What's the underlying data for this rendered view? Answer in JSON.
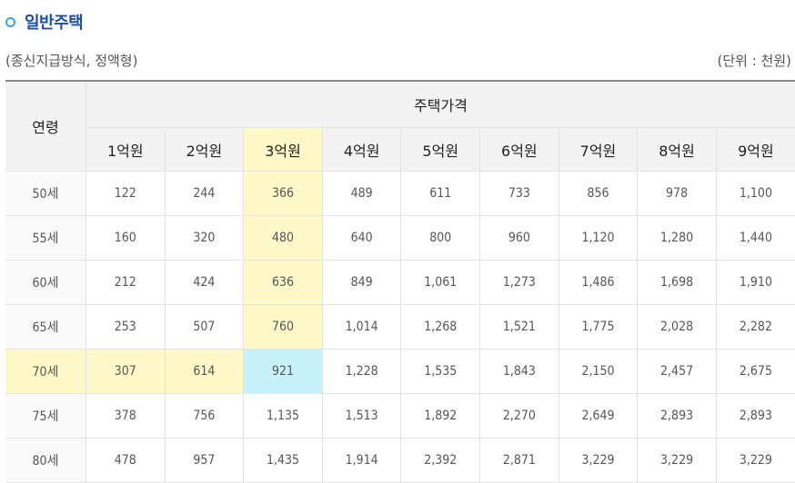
{
  "section": {
    "title": "일반주택",
    "subtitle": "(종신지급방식, 정액형)",
    "unit": "(단위 : 천원)"
  },
  "table": {
    "age_header": "연령",
    "group_header": "주택가격",
    "price_headers": [
      "1억원",
      "2억원",
      "3억원",
      "4억원",
      "5억원",
      "6억원",
      "7억원",
      "8억원",
      "9억원"
    ],
    "rows": [
      {
        "age": "50세",
        "values": [
          "122",
          "244",
          "366",
          "489",
          "611",
          "733",
          "856",
          "978",
          "1,100"
        ]
      },
      {
        "age": "55세",
        "values": [
          "160",
          "320",
          "480",
          "640",
          "800",
          "960",
          "1,120",
          "1,280",
          "1,440"
        ]
      },
      {
        "age": "60세",
        "values": [
          "212",
          "424",
          "636",
          "849",
          "1,061",
          "1,273",
          "1,486",
          "1,698",
          "1,910"
        ]
      },
      {
        "age": "65세",
        "values": [
          "253",
          "507",
          "760",
          "1,014",
          "1,268",
          "1,521",
          "1,775",
          "2,028",
          "2,282"
        ]
      },
      {
        "age": "70세",
        "values": [
          "307",
          "614",
          "921",
          "1,228",
          "1,535",
          "1,843",
          "2,150",
          "2,457",
          "2,675"
        ]
      },
      {
        "age": "75세",
        "values": [
          "378",
          "756",
          "1,135",
          "1,513",
          "1,892",
          "2,270",
          "2,649",
          "2,893",
          "2,893"
        ]
      },
      {
        "age": "80세",
        "values": [
          "478",
          "957",
          "1,435",
          "1,914",
          "2,392",
          "2,871",
          "3,229",
          "3,229",
          "3,229"
        ]
      }
    ]
  },
  "highlight": {
    "column_index": 2,
    "row_index": 4,
    "yellow": "#fff8c8",
    "cyan": "#c8f2fb"
  }
}
